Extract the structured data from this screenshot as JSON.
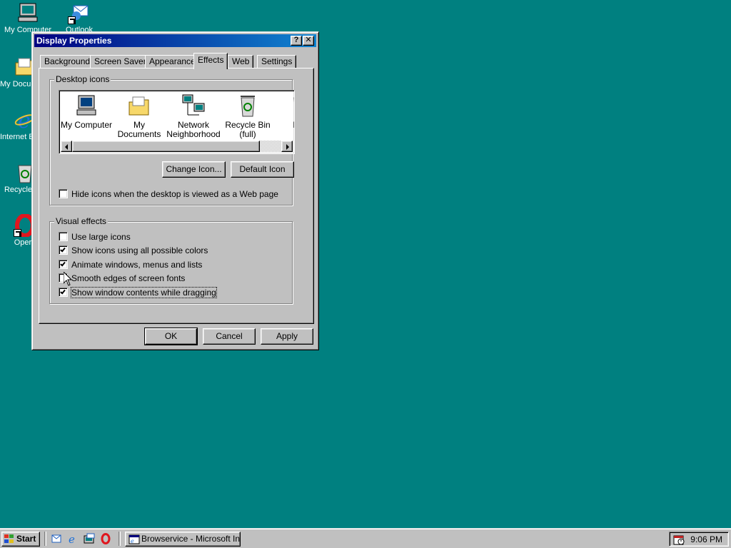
{
  "desktop": {
    "icons": [
      {
        "label": "My Computer",
        "icon": "my-computer-icon"
      },
      {
        "label": "Outlook",
        "icon": "outlook-express-icon"
      },
      {
        "label": "My Documents",
        "icon": "folder-icon"
      },
      {
        "label": "Internet Explorer",
        "icon": "internet-explorer-icon"
      },
      {
        "label": "Recycle Bin",
        "icon": "recycle-bin-icon"
      },
      {
        "label": "Opera",
        "icon": "opera-icon"
      }
    ],
    "background_color": "#008080"
  },
  "window": {
    "title": "Display Properties",
    "help_glyph": "?",
    "close_glyph": "✕",
    "tabs": [
      {
        "label": "Background",
        "active": false
      },
      {
        "label": "Screen Saver",
        "active": false
      },
      {
        "label": "Appearance",
        "active": false
      },
      {
        "label": "Effects",
        "active": true
      },
      {
        "label": "Web",
        "active": false
      },
      {
        "label": "Settings",
        "active": false
      }
    ]
  },
  "desktop_icons_group": {
    "title": "Desktop icons",
    "items": [
      {
        "label_line1": "My Computer",
        "label_line2": ""
      },
      {
        "label_line1": "My Documents",
        "label_line2": ""
      },
      {
        "label_line1": "Network",
        "label_line2": "Neighborhood"
      },
      {
        "label_line1": "Recycle Bin",
        "label_line2": "(full)"
      },
      {
        "label_line1": "Rec",
        "label_line2": "(e"
      }
    ],
    "change_icon_label": "Change Icon...",
    "default_icon_label": "Default Icon",
    "hide_icons_label": "Hide icons when the desktop is viewed as a Web page",
    "hide_icons_checked": false
  },
  "visual_effects_group": {
    "title": "Visual effects",
    "options": [
      {
        "label": "Use large icons",
        "checked": false
      },
      {
        "label": "Show icons using all possible colors",
        "checked": true
      },
      {
        "label": "Animate windows, menus and lists",
        "checked": true
      },
      {
        "label": "Smooth edges of screen fonts",
        "checked": false
      },
      {
        "label": "Show window contents while dragging",
        "checked": true
      }
    ]
  },
  "footer": {
    "ok_label": "OK",
    "cancel_label": "Cancel",
    "apply_label": "Apply"
  },
  "taskbar": {
    "start_label": "Start",
    "quick_launch": [
      "outlook-express-icon",
      "internet-explorer-icon",
      "show-desktop-icon",
      "opera-icon"
    ],
    "task_label": "Browservice - Microsoft Int...",
    "clock": "9:06 PM"
  }
}
